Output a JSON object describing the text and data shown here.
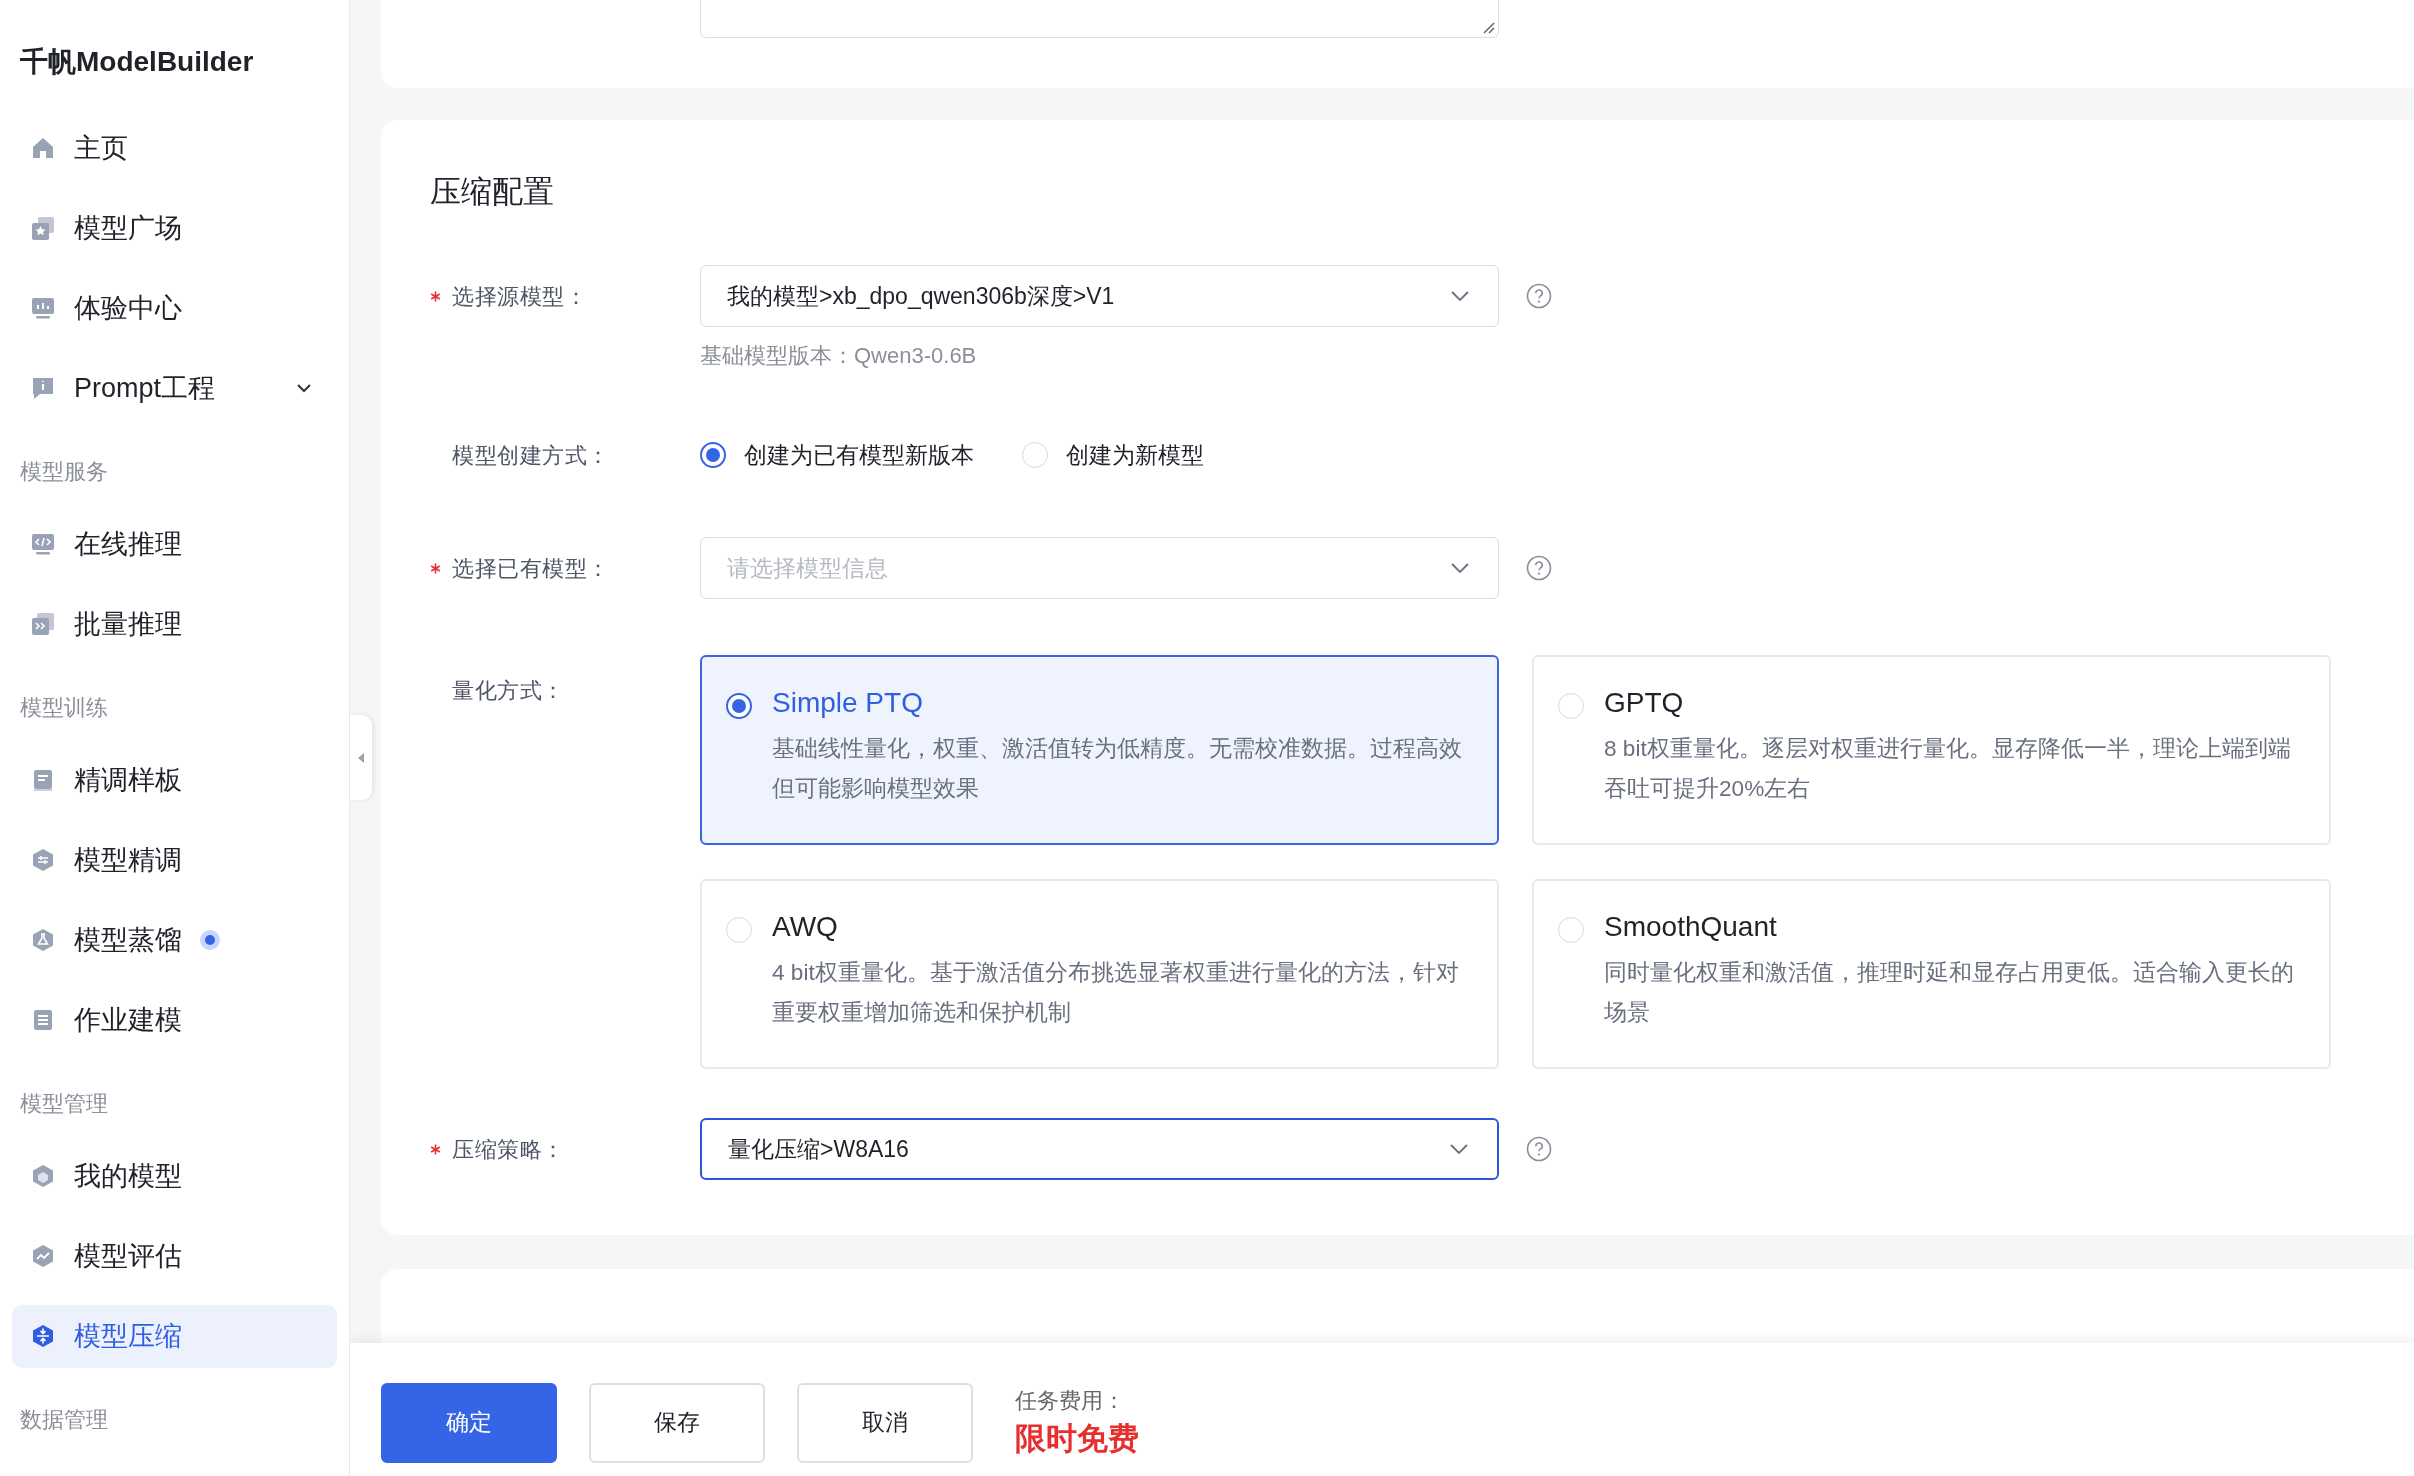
{
  "app": {
    "title": "千帆ModelBuilder"
  },
  "sidebar": [
    {
      "kind": "item",
      "label": "主页",
      "selected": false
    },
    {
      "kind": "item",
      "label": "模型广场",
      "selected": false
    },
    {
      "kind": "item",
      "label": "体验中心",
      "selected": false
    },
    {
      "kind": "item",
      "label": "Prompt工程",
      "selected": false,
      "expanded": false
    },
    {
      "kind": "section",
      "label": "模型服务"
    },
    {
      "kind": "item",
      "label": "在线推理",
      "selected": false
    },
    {
      "kind": "item",
      "label": "批量推理",
      "selected": false
    },
    {
      "kind": "section",
      "label": "模型训练"
    },
    {
      "kind": "item",
      "label": "精调样板",
      "selected": false
    },
    {
      "kind": "item",
      "label": "模型精调",
      "selected": false
    },
    {
      "kind": "item",
      "label": "模型蒸馏",
      "selected": false,
      "new_dot": true
    },
    {
      "kind": "item",
      "label": "作业建模",
      "selected": false
    },
    {
      "kind": "section",
      "label": "模型管理"
    },
    {
      "kind": "item",
      "label": "我的模型",
      "selected": false
    },
    {
      "kind": "item",
      "label": "模型评估",
      "selected": false
    },
    {
      "kind": "item",
      "label": "模型压缩",
      "selected": true
    },
    {
      "kind": "section",
      "label": "数据管理"
    }
  ],
  "compression": {
    "title": "压缩配置",
    "source_model": {
      "label": "选择源模型：",
      "required": true,
      "value": "我的模型>xb_dpo_qwen306b深度>V1",
      "focused": false,
      "hint": "基础模型版本：Qwen3-0.6B"
    },
    "create_mode": {
      "label": "模型创建方式：",
      "required": false,
      "options": [
        {
          "label": "创建为已有模型新版本",
          "selected": true
        },
        {
          "label": "创建为新模型",
          "selected": false
        }
      ]
    },
    "existing_model": {
      "label": "选择已有模型：",
      "required": true,
      "placeholder": "请选择模型信息",
      "focused": false
    },
    "quantization": {
      "label": "量化方式：",
      "required": false,
      "options": [
        {
          "title": "Simple PTQ",
          "description": "基础线性量化，权重、激活值转为低精度。无需校准数据。过程高效但可能影响模型效果",
          "selected": true
        },
        {
          "title": "GPTQ",
          "description": "8 bit权重量化。逐层对权重进行量化。显存降低一半，理论上端到端吞吐可提升20%左右",
          "selected": false
        },
        {
          "title": "AWQ",
          "description": "4 bit权重量化。基于激活值分布挑选显著权重进行量化的方法，针对重要权重增加筛选和保护机制",
          "selected": false
        },
        {
          "title": "SmoothQuant",
          "description": "同时量化权重和激活值，推理时延和显存占用更低。适合输入更长的场景",
          "selected": false
        }
      ]
    },
    "strategy": {
      "label": "压缩策略：",
      "required": true,
      "value": "量化压缩>W8A16",
      "focused": true
    }
  },
  "footer": {
    "buttons": [
      {
        "label": "确定",
        "kind": "primary"
      },
      {
        "label": "保存",
        "kind": "default"
      },
      {
        "label": "取消",
        "kind": "default"
      }
    ],
    "cost_label": "任务费用：",
    "cost_value": "限时免费"
  }
}
